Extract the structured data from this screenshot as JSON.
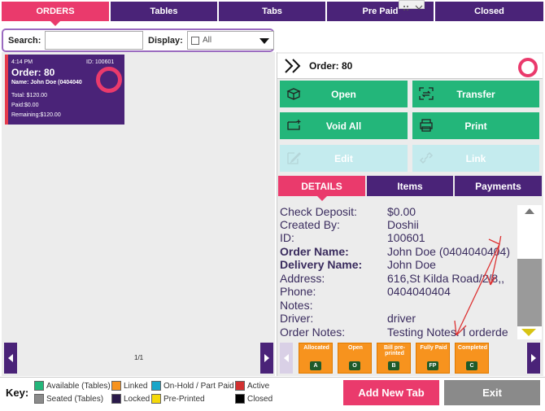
{
  "top_tabs": [
    {
      "label": "ORDERS"
    },
    {
      "label": "Tables"
    },
    {
      "label": "Tabs"
    },
    {
      "label": "Pre Paid"
    },
    {
      "label": "Closed"
    }
  ],
  "search": {
    "label": "Search:",
    "value": ""
  },
  "display": {
    "label": "Display:",
    "selected": "All"
  },
  "order_card": {
    "time": "4:14 PM",
    "id": "ID: 100601",
    "title": "Order: 80",
    "name": "Name: John Doe (0404040",
    "total": "Total: $120.00",
    "paid": "Paid:$0.00",
    "remaining": "Remaining:$120.00"
  },
  "pagination": {
    "text": "1/1"
  },
  "order_header": {
    "title": "Order: 80"
  },
  "actions": {
    "open": "Open",
    "transfer": "Transfer",
    "void_all": "Void All",
    "print": "Print",
    "edit": "Edit",
    "link": "Link"
  },
  "detail_tabs": [
    {
      "label": "DETAILS"
    },
    {
      "label": "Items"
    },
    {
      "label": "Payments"
    }
  ],
  "details": [
    {
      "key": "Check Deposit:",
      "value": "$0.00",
      "bold": false
    },
    {
      "key": "Created By:",
      "value": "Doshii",
      "bold": false
    },
    {
      "key": "ID:",
      "value": "100601",
      "bold": false
    },
    {
      "key": "Order Name:",
      "value": "John Doe (0404040404)",
      "bold": true
    },
    {
      "key": "Delivery Name:",
      "value": "John Doe",
      "bold": true
    },
    {
      "key": "Address:",
      "value": "616,St Kilda Road/2/8,,",
      "bold": false
    },
    {
      "key": "Phone:",
      "value": "0404040404",
      "bold": false
    },
    {
      "key": "Notes:",
      "value": "",
      "bold": false
    },
    {
      "key": "Driver:",
      "value": "driver",
      "bold": false
    },
    {
      "key": "Order Notes:",
      "value": "Testing Notes. I orderde",
      "bold": false
    }
  ],
  "status_buttons": [
    {
      "label": "Allocated",
      "letter": "A"
    },
    {
      "label": "Open",
      "letter": "O"
    },
    {
      "label": "Bill pre-printed",
      "letter": "B"
    },
    {
      "label": "Fully Paid",
      "letter": "FP"
    },
    {
      "label": "Completed",
      "letter": "C"
    }
  ],
  "legend": {
    "title": "Key:",
    "items": [
      {
        "label": "Available (Tables)",
        "color": "#23b67a"
      },
      {
        "label": "Seated (Tables)",
        "color": "#8a8a8a"
      },
      {
        "label": "Linked",
        "color": "#f7931e"
      },
      {
        "label": "Locked",
        "color": "#2a1a4a"
      },
      {
        "label": "On-Hold / Part Paid",
        "color": "#1aa6c9"
      },
      {
        "label": "Pre-Printed",
        "color": "#f5d90a"
      },
      {
        "label": "Active",
        "color": "#d23030"
      },
      {
        "label": "Closed",
        "color": "#000000"
      }
    ]
  },
  "bottom_buttons": {
    "add_new_tab": "Add New Tab",
    "exit": "Exit"
  },
  "colors": {
    "purple": "#4a2378",
    "pink": "#ea3a6c",
    "green": "#23b67a",
    "orange": "#f7931e",
    "grey": "#8a8a8a"
  }
}
